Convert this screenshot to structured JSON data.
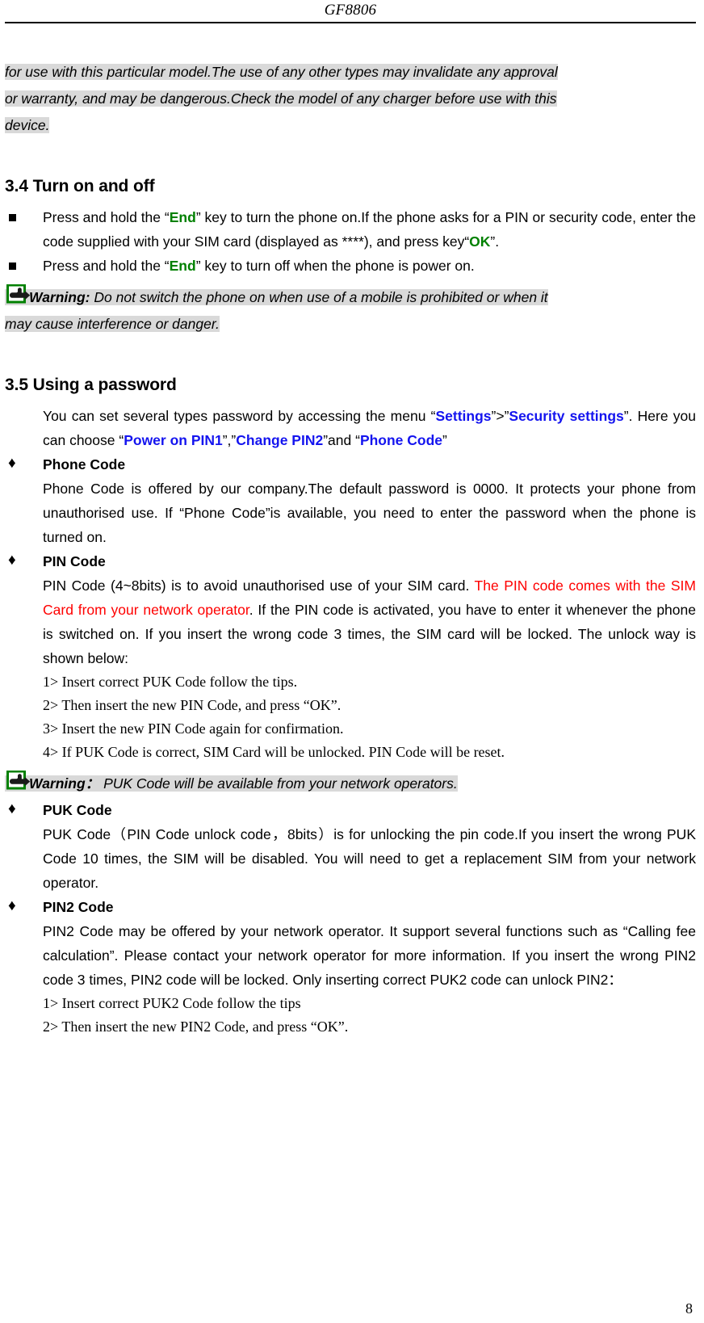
{
  "header": {
    "running_title": "GF8806"
  },
  "intro_highlight": {
    "line1": "for use with this particular model.The use of any other types may invalidate any approval",
    "line2": "or warranty, and may be dangerous.Check the model of any charger before use with this",
    "line3": "device."
  },
  "section_34": {
    "heading": "3.4 Turn on and off",
    "bullets": [
      {
        "pre": "Press and hold the “",
        "key1": "End",
        "mid": "” key to turn the phone on.If the phone asks for a PIN or security code, enter the code supplied with your SIM card (displayed as ****), and press key“",
        "key2": "OK",
        "post": "”."
      },
      {
        "pre": "Press and hold the “",
        "key1": "End",
        "post": "” key to turn off when the phone is power on."
      }
    ],
    "warning": {
      "label": "Warning:",
      "line1": "Do not switch the phone on when use of a mobile is prohibited or when it",
      "line2": "may cause interference or danger."
    }
  },
  "section_35": {
    "heading": "3.5 Using a password",
    "intro": {
      "t1": "You can set several types password by accessing the menu “",
      "menu1": "Settings",
      "t2": "”>”",
      "menu2": "Security settings",
      "t3": "”. Here you can choose “",
      "menu3": "Power on PIN1",
      "t4": "”,”",
      "menu4": "Change PIN2",
      "t5": "”and “",
      "menu5": "Phone Code",
      "t6": "”"
    },
    "items": [
      {
        "title": "Phone Code",
        "body": "Phone Code is offered by our company.The default password is 0000. It protects your phone from unauthorised use. If “Phone Code”is available, you need to enter the password when the phone is turned on."
      },
      {
        "title": "PIN Code",
        "body_pre": "PIN Code (4~8bits) is to avoid unauthorised use of your SIM card. ",
        "body_red": "The PIN code comes with the SIM Card from your network operator",
        "body_post": ". If the PIN code is activated, you have to enter it whenever the phone is switched on. If you insert the wrong code 3 times, the SIM card will be locked. The unlock way is shown below:",
        "steps": [
          "1> Insert correct PUK Code follow the tips.",
          "2> Then insert the new PIN Code, and press “OK”.",
          "3> Insert the new PIN Code again for confirmation.",
          "4> If PUK Code is correct, SIM Card will be unlocked. PIN Code will be reset."
        ],
        "warning": {
          "label": "Warning：",
          "text": "PUK Code will be available from your network operators."
        }
      },
      {
        "title": "PUK Code",
        "body": "PUK Code（PIN Code unlock code，8bits）is for unlocking the pin code.If you insert the wrong PUK Code 10 times, the SIM will be disabled. You will need to get a replacement SIM from your network operator."
      },
      {
        "title": "PIN2 Code",
        "body": "PIN2 Code may be offered by your network operator. It support several functions such as “Calling fee calculation”. Please contact your network operator for more information. If you insert the wrong PIN2 code 3 times, PIN2 code will be locked. Only inserting correct PUK2 code can unlock PIN2：",
        "steps": [
          "1> Insert correct PUK2 Code follow the tips",
          "2> Then insert the new PIN2 Code, and press “OK”."
        ]
      }
    ]
  },
  "footer": {
    "page_number": "8"
  },
  "markers": {
    "diamond": "♦"
  },
  "colors": {
    "highlight": "#d9d9d9",
    "green_key": "#008000",
    "blue_menu": "#1414ef",
    "red_note": "#ff0000"
  }
}
